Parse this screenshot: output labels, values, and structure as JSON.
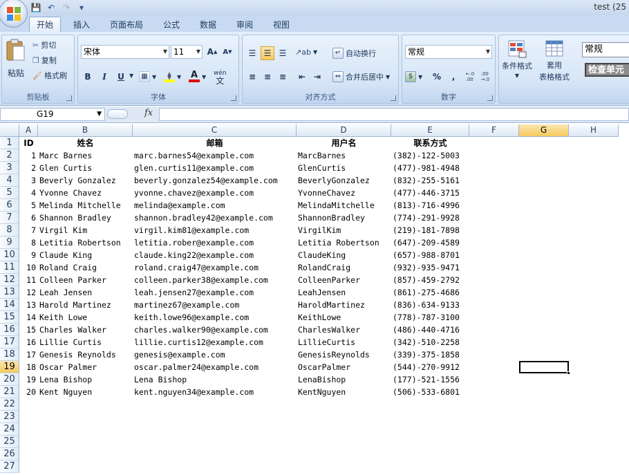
{
  "window": {
    "title": "test (25"
  },
  "qat": {
    "save": "💾",
    "undo": "↶",
    "redo": "↷",
    "customize": "▾"
  },
  "tabs": [
    "开始",
    "插入",
    "页面布局",
    "公式",
    "数据",
    "审阅",
    "视图"
  ],
  "ribbon": {
    "clipboard": {
      "label": "剪贴板",
      "paste": "粘贴",
      "cut": "剪切",
      "copy": "复制",
      "format_painter": "格式刷"
    },
    "font": {
      "label": "字体",
      "name": "宋体",
      "size": "11",
      "grow": "A",
      "shrink": "A",
      "bold": "B",
      "italic": "I",
      "underline": "U",
      "font_color_letter": "A",
      "phonetic": "wén"
    },
    "alignment": {
      "label": "对齐方式",
      "wrap_text": "自动换行",
      "merge_center": "合并后居中"
    },
    "number": {
      "label": "数字",
      "format": "常规",
      "percent": "%",
      "comma": ",",
      "inc_decimal": "+.0 .00",
      "dec_decimal": ".00 →.0"
    },
    "styles": {
      "conditional": "条件格式",
      "table_format_1": "套用",
      "table_format_2": "表格格式",
      "style_normal": "常规",
      "style_check": "检查单元"
    }
  },
  "formula_bar": {
    "name_box": "G19",
    "fx": "fx",
    "formula": ""
  },
  "columns": [
    "A",
    "B",
    "C",
    "D",
    "E",
    "F",
    "G",
    "H"
  ],
  "selected": {
    "column": "G",
    "row": "19"
  },
  "sheet": {
    "headers": [
      "ID",
      "姓名",
      "邮箱",
      "用户名",
      "联系方式"
    ],
    "rows": [
      [
        "1",
        "Marc Barnes",
        "marc.barnes54@example.com",
        "MarcBarnes",
        "(382)-122-5003"
      ],
      [
        "2",
        "Glen Curtis",
        "glen.curtis11@example.com",
        "GlenCurtis",
        "(477)-981-4948"
      ],
      [
        "3",
        "Beverly Gonzalez",
        "beverly.gonzalez54@example.com",
        "BeverlyGonzalez",
        "(832)-255-5161"
      ],
      [
        "4",
        "Yvonne Chavez",
        "yvonne.chavez@example.com",
        "YvonneChavez",
        "(477)-446-3715"
      ],
      [
        "5",
        "Melinda Mitchelle",
        "melinda@example.com",
        "MelindaMitchelle",
        "(813)-716-4996"
      ],
      [
        "6",
        "Shannon Bradley",
        "shannon.bradley42@example.com",
        "ShannonBradley",
        "(774)-291-9928"
      ],
      [
        "7",
        "Virgil Kim",
        "virgil.kim81@example.com",
        "VirgilKim",
        "(219)-181-7898"
      ],
      [
        "8",
        "Letitia Robertson",
        "letitia.rober@example.com",
        "Letitia Robertson",
        "(647)-209-4589"
      ],
      [
        "9",
        "Claude King",
        "claude.king22@example.com",
        "ClaudeKing",
        "(657)-988-8701"
      ],
      [
        "10",
        "Roland Craig",
        "roland.craig47@example.com",
        "RolandCraig",
        "(932)-935-9471"
      ],
      [
        "11",
        "Colleen Parker",
        "colleen.parker38@example.com",
        "ColleenParker",
        "(857)-459-2792"
      ],
      [
        "12",
        "Leah Jensen",
        "leah.jensen27@example.com",
        "LeahJensen",
        "(861)-275-4686"
      ],
      [
        "13",
        "Harold Martinez",
        "martinez67@example.com",
        "HaroldMartinez",
        "(836)-634-9133"
      ],
      [
        "14",
        "Keith Lowe",
        "keith.lowe96@example.com",
        "KeithLowe",
        "(778)-787-3100"
      ],
      [
        "15",
        "Charles Walker",
        "charles.walker90@example.com",
        "CharlesWalker",
        "(486)-440-4716"
      ],
      [
        "16",
        "Lillie Curtis",
        "lillie.curtis12@example.com",
        "LillieCurtis",
        "(342)-510-2258"
      ],
      [
        "17",
        "Genesis Reynolds",
        "genesis@example.com",
        "GenesisReynolds",
        "(339)-375-1858"
      ],
      [
        "18",
        "Oscar Palmer",
        "oscar.palmer24@example.com",
        "OscarPalmer",
        "(544)-270-9912"
      ],
      [
        "19",
        "Lena Bishop",
        "Lena Bishop",
        "LenaBishop",
        "(177)-521-1556"
      ],
      [
        "20",
        "Kent Nguyen",
        "kent.nguyen34@example.com",
        "KentNguyen",
        "(506)-533-6801"
      ]
    ],
    "row_numbers": [
      "1",
      "2",
      "3",
      "4",
      "5",
      "6",
      "7",
      "8",
      "9",
      "10",
      "11",
      "12",
      "13",
      "14",
      "15",
      "16",
      "17",
      "18",
      "19",
      "20",
      "21",
      "22",
      "23",
      "24",
      "25",
      "26",
      "27"
    ]
  }
}
